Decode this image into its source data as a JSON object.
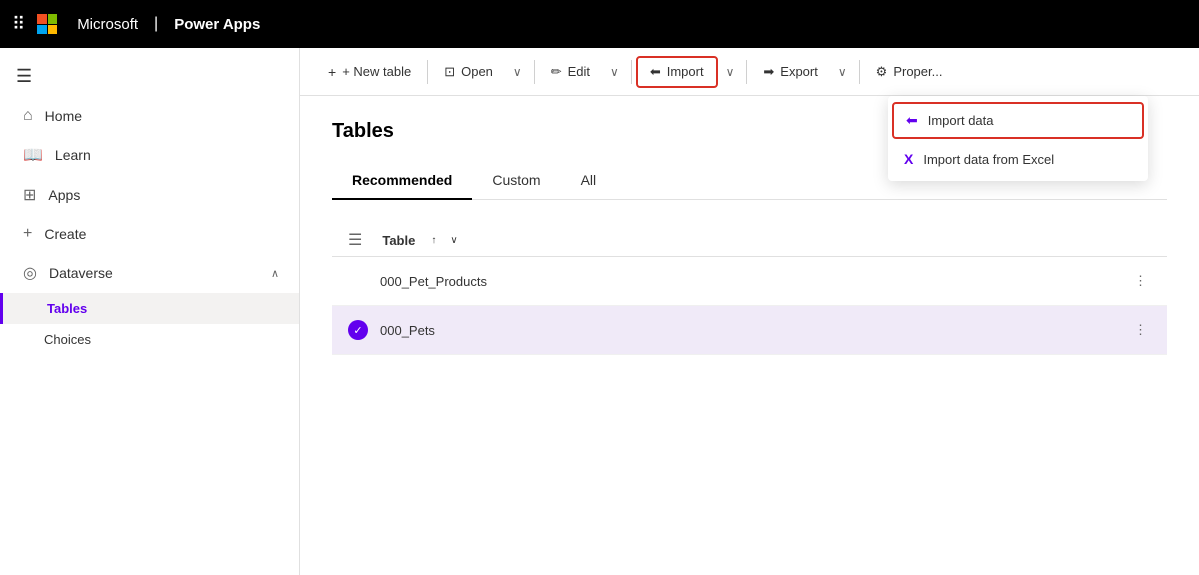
{
  "topbar": {
    "brand": "Microsoft",
    "appname": "Power Apps",
    "grid_icon": "⊞"
  },
  "sidebar": {
    "hamburger_icon": "☰",
    "items": [
      {
        "id": "home",
        "label": "Home",
        "icon": "⌂"
      },
      {
        "id": "learn",
        "label": "Learn",
        "icon": "📖"
      },
      {
        "id": "apps",
        "label": "Apps",
        "icon": "⊞"
      },
      {
        "id": "create",
        "label": "Create",
        "icon": "+"
      },
      {
        "id": "dataverse",
        "label": "Dataverse",
        "icon": "◎",
        "expanded": true
      }
    ],
    "dataverse_children": [
      {
        "id": "tables",
        "label": "Tables",
        "active": true
      },
      {
        "id": "choices",
        "label": "Choices",
        "active": false
      }
    ]
  },
  "toolbar": {
    "new_table_label": "+ New table",
    "open_label": "Open",
    "edit_label": "Edit",
    "import_label": "Import",
    "export_label": "Export",
    "properties_label": "Proper...",
    "open_icon": "⊡",
    "edit_icon": "✏",
    "import_icon": "←⊡",
    "export_icon": "⊡→",
    "gear_icon": "⚙"
  },
  "dropdown": {
    "items": [
      {
        "id": "import-data",
        "label": "Import data",
        "icon": "←⊡",
        "highlighted": true
      },
      {
        "id": "import-excel",
        "label": "Import data from Excel",
        "icon": "X"
      }
    ]
  },
  "content": {
    "title": "Tables",
    "tabs": [
      {
        "id": "recommended",
        "label": "Recommended",
        "active": true
      },
      {
        "id": "custom",
        "label": "Custom",
        "active": false
      },
      {
        "id": "all",
        "label": "All",
        "active": false
      }
    ],
    "table_header": "Table",
    "rows": [
      {
        "id": "000_Pet_Products",
        "name": "000_Pet_Products",
        "selected": false
      },
      {
        "id": "000_Pets",
        "name": "000_Pets",
        "selected": true
      }
    ]
  },
  "colors": {
    "accent": "#6200ee",
    "danger": "#d93025",
    "active_border": "#000"
  }
}
